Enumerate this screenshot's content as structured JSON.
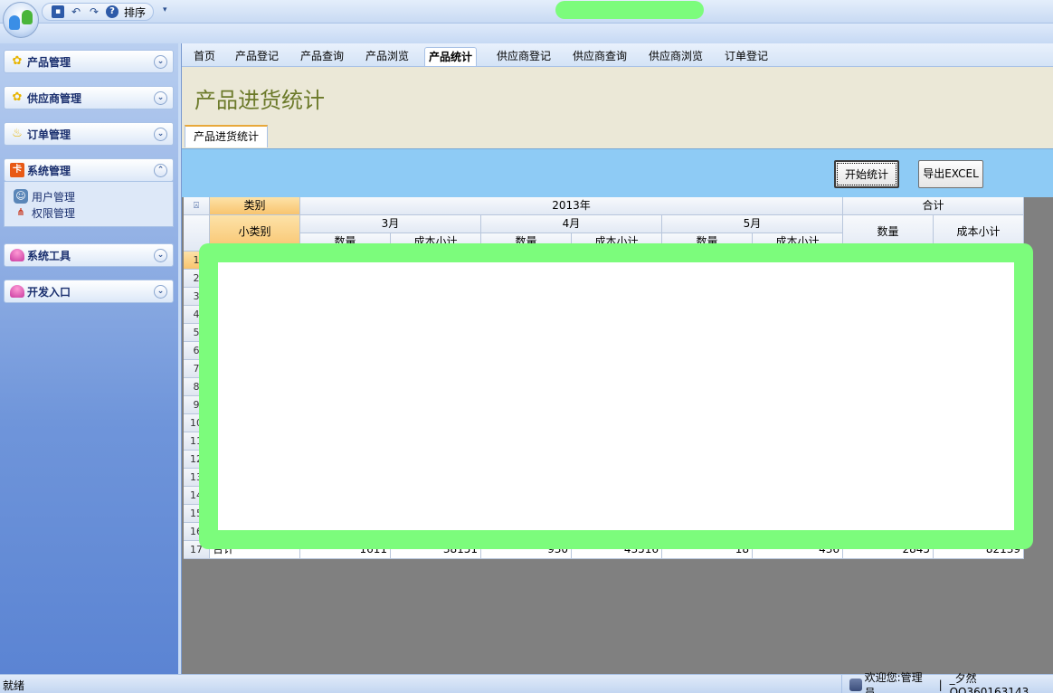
{
  "quick_access": {
    "sort_label": "排序",
    "more_glyph": "▾"
  },
  "sidebar": {
    "groups": [
      {
        "label": "产品管理",
        "chevron": "⌄"
      },
      {
        "label": "供应商管理",
        "chevron": "⌄"
      },
      {
        "label": "订单管理",
        "chevron": "⌄"
      },
      {
        "label": "系统管理",
        "chevron": "⌃",
        "items": [
          {
            "label": "用户管理"
          },
          {
            "label": "权限管理"
          }
        ]
      },
      {
        "label": "系统工具",
        "chevron": "⌄"
      },
      {
        "label": "开发入口",
        "chevron": "⌄"
      }
    ]
  },
  "tabs": [
    {
      "label": "首页"
    },
    {
      "label": "产品登记"
    },
    {
      "label": "产品查询"
    },
    {
      "label": "产品浏览"
    },
    {
      "label": "产品统计",
      "active": true
    },
    {
      "label": "供应商登记"
    },
    {
      "label": "供应商查询"
    },
    {
      "label": "供应商浏览"
    },
    {
      "label": "订单登记"
    }
  ],
  "page": {
    "title": "产品进货统计",
    "subtab": "产品进货统计",
    "start_button": "开始统计",
    "export_button": "导出EXCEL"
  },
  "grid": {
    "corner_glyph": "⍓",
    "category_header": "类别",
    "subcategory_header": "小类别",
    "year_header": "2013年",
    "total_header": "合计",
    "months": [
      "3月",
      "4月",
      "5月"
    ],
    "qty_header": "数量",
    "cost_header": "成本小计",
    "row_numbers": [
      "1",
      "2",
      "3",
      "4",
      "5",
      "6",
      "7",
      "8",
      "9",
      "10",
      "11",
      "12",
      "13",
      "14",
      "15",
      "16",
      "17"
    ],
    "total_row": {
      "label": "合计",
      "values": [
        "1611",
        "38151",
        "930",
        "43516",
        "18",
        "436",
        "2845",
        "82139"
      ]
    }
  },
  "status": {
    "left": "就绪",
    "welcome": "欢迎您:管理员",
    "separator": "|",
    "contact": "_夕然QQ360163143"
  }
}
